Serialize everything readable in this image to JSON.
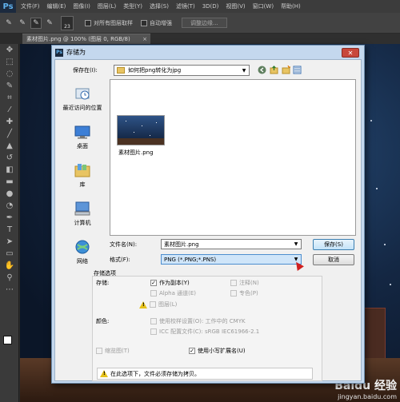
{
  "app": {
    "logo": "Ps",
    "menu": [
      "文件(F)",
      "编辑(E)",
      "图像(I)",
      "图层(L)",
      "类型(Y)",
      "选择(S)",
      "滤镜(T)",
      "3D(D)",
      "视图(V)",
      "窗口(W)",
      "帮助(H)"
    ]
  },
  "options_bar": {
    "brush_size": "23",
    "sample_all_layers": "对所有图层取样",
    "auto_enhance": "自动增强",
    "refine_edge": "调整边缘..."
  },
  "document_tab": {
    "title": "素材图片.png @ 100% (图层 0, RGB/8)",
    "close": "×"
  },
  "watermark": {
    "line1": "Baidu 经验",
    "line2": "jingyan.baidu.com"
  },
  "dialog": {
    "title": "存储为",
    "close": "✕",
    "save_in_label": "保存在(I):",
    "save_in_value": "如何把png转化为jpg",
    "places": [
      {
        "label": "最近访问的位置",
        "icon": "recent-places-icon"
      },
      {
        "label": "桌面",
        "icon": "desktop-icon"
      },
      {
        "label": "库",
        "icon": "libraries-icon"
      },
      {
        "label": "计算机",
        "icon": "computer-icon"
      },
      {
        "label": "网络",
        "icon": "network-icon"
      }
    ],
    "file_item": "素材图片.png",
    "filename_label": "文件名(N):",
    "filename_value": "素材图片.png",
    "format_label": "格式(F):",
    "format_value": "PNG (*.PNG;*.PNS)",
    "save_button": "保存(S)",
    "cancel_button": "取消",
    "save_options_title": "存储选项",
    "save_label": "存储:",
    "opt_as_copy": "作为副本(Y)",
    "opt_notes": "注释(N)",
    "opt_alpha": "Alpha 通道(E)",
    "opt_spot": "专色(P)",
    "opt_layers": "图层(L)",
    "color_label": "颜色:",
    "opt_proof": "使用校样设置(O): 工作中的 CMYK",
    "opt_icc": "ICC 配置文件(C): sRGB IEC61966-2.1",
    "opt_thumbnail": "缩览图(T)",
    "opt_lowercase": "使用小写扩展名(U)",
    "notice": "在此选项下，文件必须存储为拷贝。"
  }
}
